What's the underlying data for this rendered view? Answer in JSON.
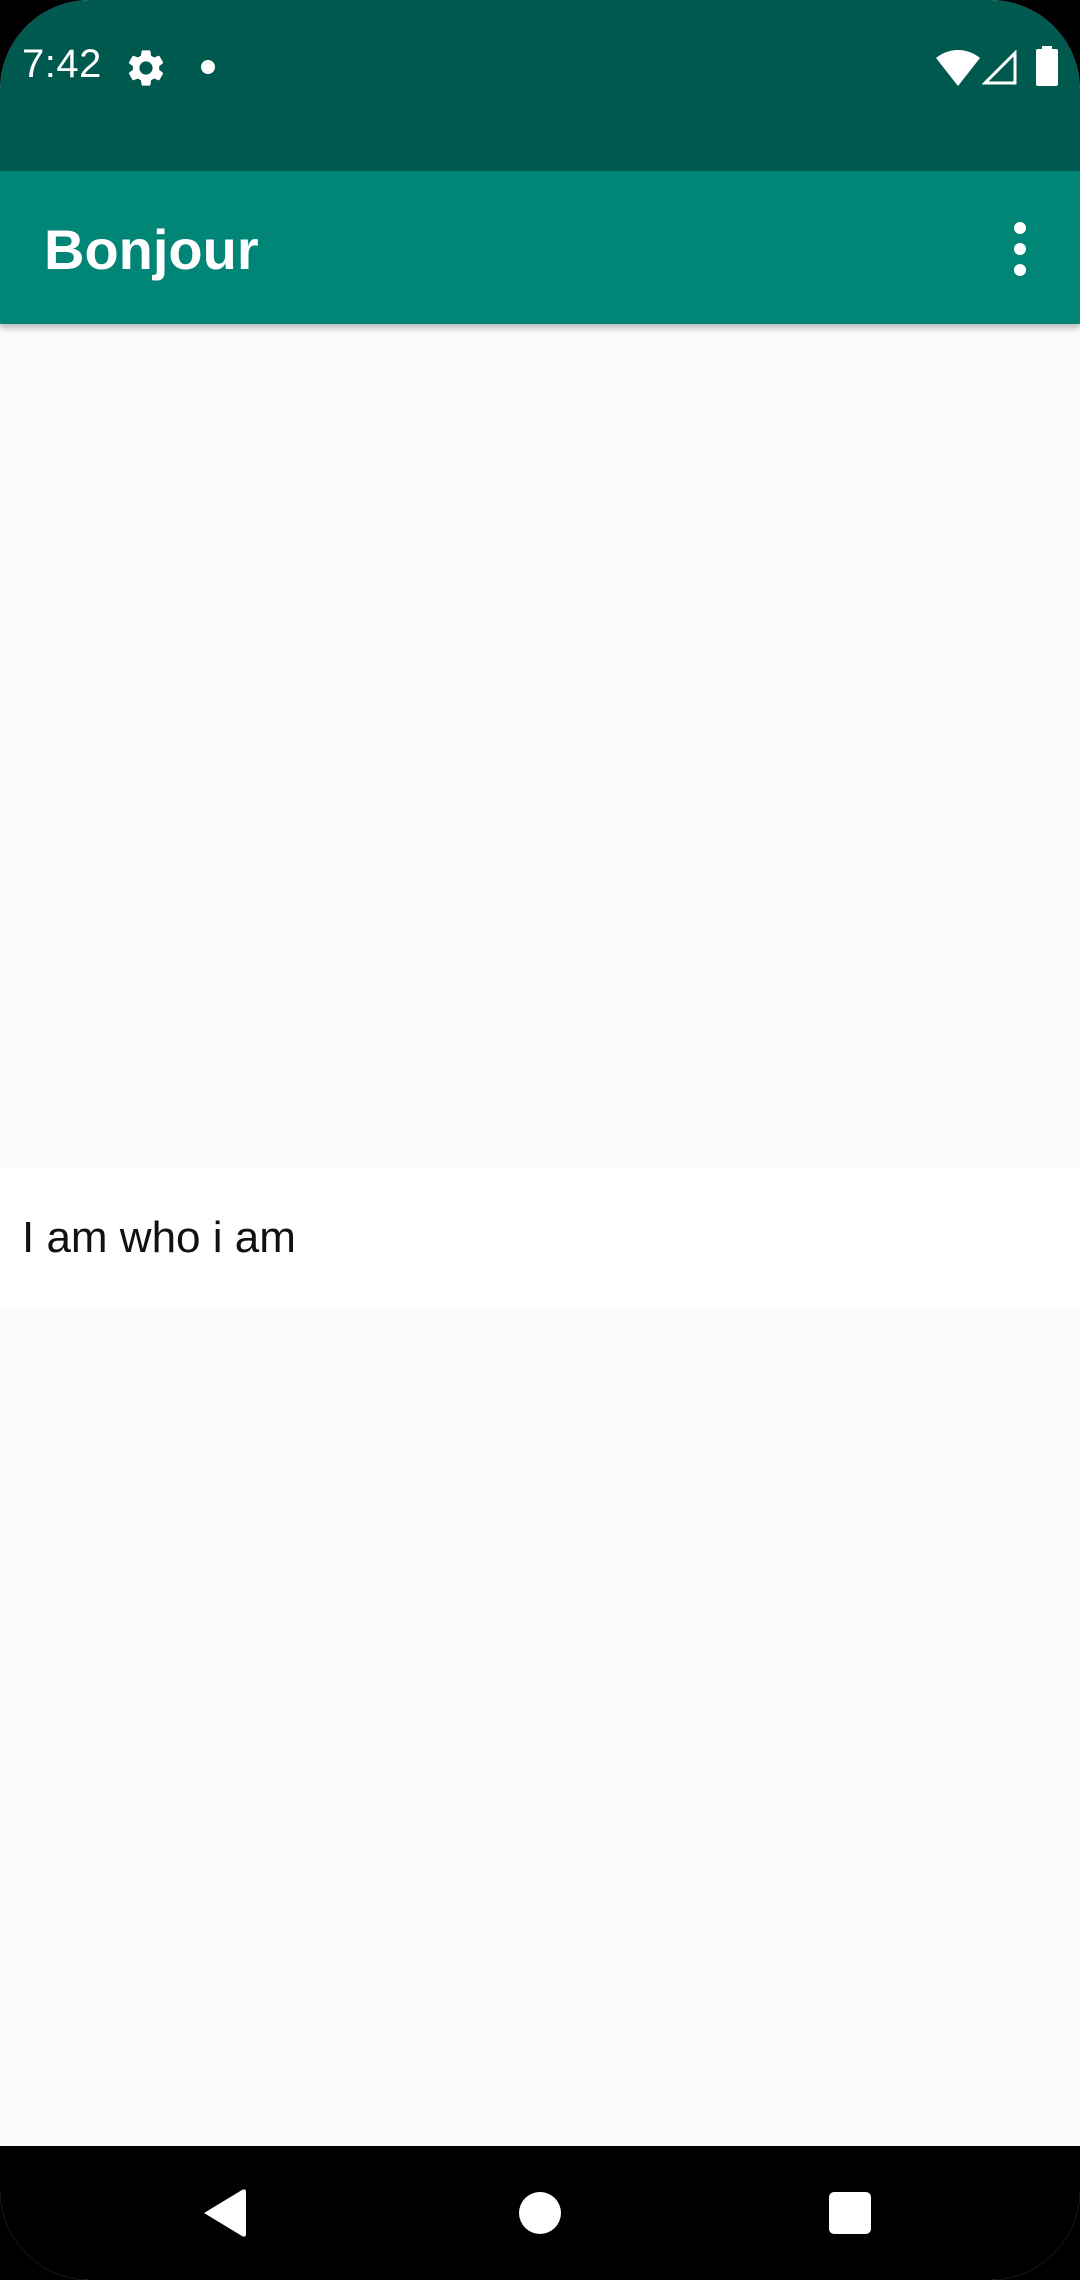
{
  "status_bar": {
    "time": "7:42",
    "icons": [
      "gear-icon",
      "notification-dot-icon",
      "wifi-icon",
      "signal-icon",
      "battery-icon"
    ],
    "background_color": "#00594f"
  },
  "app_bar": {
    "title": "Bonjour",
    "overflow_icon": "more-vert-icon",
    "background_color": "#008577"
  },
  "content": {
    "text_row": {
      "label": "I am who i am"
    }
  },
  "nav_bar": {
    "buttons": [
      "back-icon",
      "home-icon",
      "recents-icon"
    ]
  }
}
